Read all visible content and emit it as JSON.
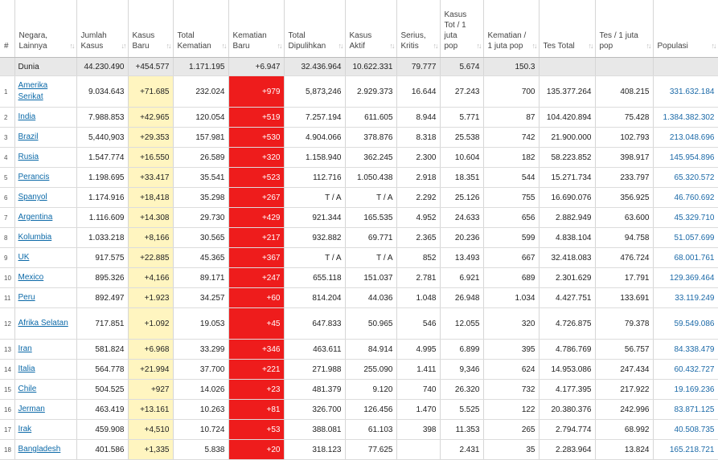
{
  "headers": [
    {
      "key": "idx",
      "label": "#"
    },
    {
      "key": "name",
      "label": "Negara, Lainnya"
    },
    {
      "key": "jk",
      "label": "Jumlah Kasus"
    },
    {
      "key": "kb",
      "label": "Kasus Baru"
    },
    {
      "key": "tk",
      "label": "Total Kematian"
    },
    {
      "key": "kem",
      "label": "Kematian Baru"
    },
    {
      "key": "td",
      "label": "Total Dipulihkan"
    },
    {
      "key": "ka",
      "label": "Kasus Aktif"
    },
    {
      "key": "sk",
      "label": "Serius, Kritis"
    },
    {
      "key": "kt",
      "label": "Kasus Tot / 1 juta pop"
    },
    {
      "key": "kj",
      "label": "Kematian / 1 juta pop"
    },
    {
      "key": "tt",
      "label": "Tes Total"
    },
    {
      "key": "tj",
      "label": "Tes / 1 juta pop"
    },
    {
      "key": "pop",
      "label": "Populasi"
    }
  ],
  "world": {
    "idx": "",
    "name": "Dunia",
    "jk": "44.230.490",
    "kb": "+454.577",
    "tk": "1.171.195",
    "kem": "+6.947",
    "td": "32.436.964",
    "ka": "10.622.331",
    "sk": "79.777",
    "kt": "5.674",
    "kj": "150.3",
    "tt": "",
    "tj": "",
    "pop": ""
  },
  "rows": [
    {
      "idx": "1",
      "name": "Amerika Serikat",
      "jk": "9.034.643",
      "kb": "+71.685",
      "tk": "232.024",
      "kem": "+979",
      "td": "5,873,246",
      "ka": "2.929.373",
      "sk": "16.644",
      "kt": "27.243",
      "kj": "700",
      "tt": "135.377.264",
      "tj": "408.215",
      "pop": "331.632.184"
    },
    {
      "idx": "2",
      "name": "India",
      "jk": "7.988.853",
      "kb": "+42.965",
      "tk": "120.054",
      "kem": "+519",
      "td": "7.257.194",
      "ka": "611.605",
      "sk": "8.944",
      "kt": "5.771",
      "kj": "87",
      "tt": "104.420.894",
      "tj": "75.428",
      "pop": "1.384.382.302"
    },
    {
      "idx": "3",
      "name": "Brazil",
      "jk": "5,440,903",
      "kb": "+29.353",
      "tk": "157.981",
      "kem": "+530",
      "td": "4.904.066",
      "ka": "378.876",
      "sk": "8.318",
      "kt": "25.538",
      "kj": "742",
      "tt": "21.900.000",
      "tj": "102.793",
      "pop": "213.048.696"
    },
    {
      "idx": "4",
      "name": "Rusia",
      "jk": "1.547.774",
      "kb": "+16.550",
      "tk": "26.589",
      "kem": "+320",
      "td": "1.158.940",
      "ka": "362.245",
      "sk": "2.300",
      "kt": "10.604",
      "kj": "182",
      "tt": "58.223.852",
      "tj": "398.917",
      "pop": "145.954.896"
    },
    {
      "idx": "5",
      "name": "Perancis",
      "jk": "1.198.695",
      "kb": "+33.417",
      "tk": "35.541",
      "kem": "+523",
      "td": "112.716",
      "ka": "1.050.438",
      "sk": "2.918",
      "kt": "18.351",
      "kj": "544",
      "tt": "15.271.734",
      "tj": "233.797",
      "pop": "65.320.572"
    },
    {
      "idx": "6",
      "name": "Spanyol",
      "jk": "1.174.916",
      "kb": "+18,418",
      "tk": "35.298",
      "kem": "+267",
      "td": "T / A",
      "ka": "T / A",
      "sk": "2.292",
      "kt": "25.126",
      "kj": "755",
      "tt": "16.690.076",
      "tj": "356.925",
      "pop": "46.760.692"
    },
    {
      "idx": "7",
      "name": "Argentina",
      "jk": "1.116.609",
      "kb": "+14.308",
      "tk": "29.730",
      "kem": "+429",
      "td": "921.344",
      "ka": "165.535",
      "sk": "4.952",
      "kt": "24.633",
      "kj": "656",
      "tt": "2.882.949",
      "tj": "63.600",
      "pop": "45.329.710"
    },
    {
      "idx": "8",
      "name": "Kolumbia",
      "jk": "1.033.218",
      "kb": "+8,166",
      "tk": "30.565",
      "kem": "+217",
      "td": "932.882",
      "ka": "69.771",
      "sk": "2.365",
      "kt": "20.236",
      "kj": "599",
      "tt": "4.838.104",
      "tj": "94.758",
      "pop": "51.057.699"
    },
    {
      "idx": "9",
      "name": "UK",
      "jk": "917.575",
      "kb": "+22.885",
      "tk": "45.365",
      "kem": "+367",
      "td": "T / A",
      "ka": "T / A",
      "sk": "852",
      "kt": "13.493",
      "kj": "667",
      "tt": "32.418.083",
      "tj": "476.724",
      "pop": "68.001.761"
    },
    {
      "idx": "10",
      "name": "Mexico",
      "jk": "895.326",
      "kb": "+4,166",
      "tk": "89.171",
      "kem": "+247",
      "td": "655.118",
      "ka": "151.037",
      "sk": "2.781",
      "kt": "6.921",
      "kj": "689",
      "tt": "2.301.629",
      "tj": "17.791",
      "pop": "129.369.464"
    },
    {
      "idx": "11",
      "name": "Peru",
      "jk": "892.497",
      "kb": "+1.923",
      "tk": "34.257",
      "kem": "+60",
      "td": "814.204",
      "ka": "44.036",
      "sk": "1.048",
      "kt": "26.948",
      "kj": "1.034",
      "tt": "4.427.751",
      "tj": "133.691",
      "pop": "33.119.249"
    },
    {
      "idx": "12",
      "name": "Afrika Selatan",
      "jk": "717.851",
      "kb": "+1.092",
      "tk": "19.053",
      "kem": "+45",
      "td": "647.833",
      "ka": "50.965",
      "sk": "546",
      "kt": "12.055",
      "kj": "320",
      "tt": "4.726.875",
      "tj": "79.378",
      "pop": "59.549.086"
    },
    {
      "idx": "13",
      "name": "Iran",
      "jk": "581.824",
      "kb": "+6.968",
      "tk": "33.299",
      "kem": "+346",
      "td": "463.611",
      "ka": "84.914",
      "sk": "4.995",
      "kt": "6.899",
      "kj": "395",
      "tt": "4.786.769",
      "tj": "56.757",
      "pop": "84.338.479"
    },
    {
      "idx": "14",
      "name": "Italia",
      "jk": "564.778",
      "kb": "+21.994",
      "tk": "37.700",
      "kem": "+221",
      "td": "271.988",
      "ka": "255.090",
      "sk": "1.411",
      "kt": "9,346",
      "kj": "624",
      "tt": "14.953.086",
      "tj": "247.434",
      "pop": "60.432.727"
    },
    {
      "idx": "15",
      "name": "Chile",
      "jk": "504.525",
      "kb": "+927",
      "tk": "14.026",
      "kem": "+23",
      "td": "481.379",
      "ka": "9.120",
      "sk": "740",
      "kt": "26.320",
      "kj": "732",
      "tt": "4.177.395",
      "tj": "217.922",
      "pop": "19.169.236"
    },
    {
      "idx": "16",
      "name": "Jerman",
      "jk": "463.419",
      "kb": "+13.161",
      "tk": "10.263",
      "kem": "+81",
      "td": "326.700",
      "ka": "126.456",
      "sk": "1.470",
      "kt": "5.525",
      "kj": "122",
      "tt": "20.380.376",
      "tj": "242.996",
      "pop": "83.871.125"
    },
    {
      "idx": "17",
      "name": "Irak",
      "jk": "459.908",
      "kb": "+4,510",
      "tk": "10.724",
      "kem": "+53",
      "td": "388.081",
      "ka": "61.103",
      "sk": "398",
      "kt": "11.353",
      "kj": "265",
      "tt": "2.794.774",
      "tj": "68.992",
      "pop": "40.508.735"
    },
    {
      "idx": "18",
      "name": "Bangladesh",
      "jk": "401.586",
      "kb": "+1,335",
      "tk": "5.838",
      "kem": "+20",
      "td": "318.123",
      "ka": "77.625",
      "sk": "",
      "kt": "2.431",
      "kj": "35",
      "tt": "2.283.964",
      "tj": "13.824",
      "pop": "165.218.721"
    }
  ],
  "sort_icon": "sort-arrows-icon"
}
